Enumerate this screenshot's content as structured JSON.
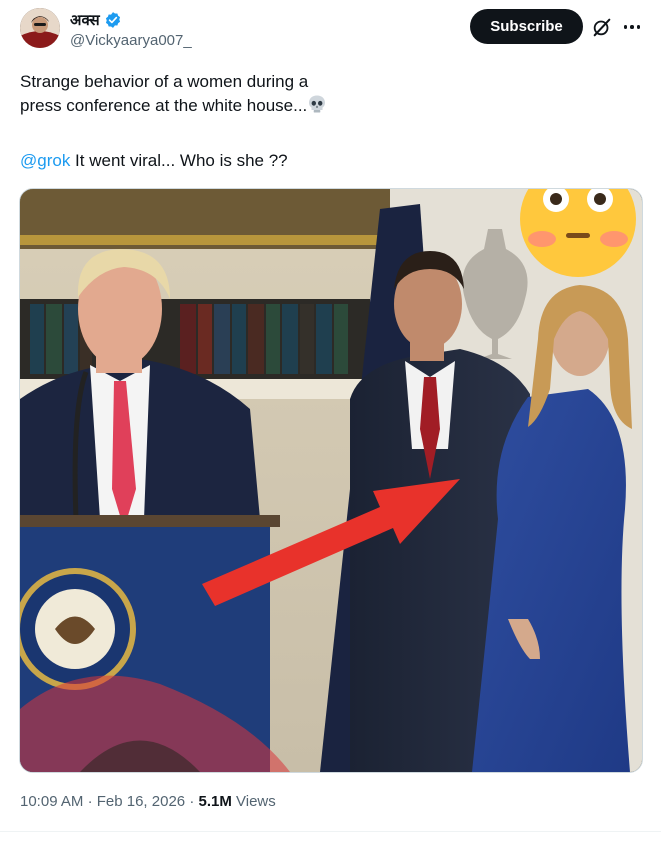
{
  "author": {
    "display_name": "अक्स",
    "handle": "@Vickyaarya007_"
  },
  "actions": {
    "subscribe_label": "Subscribe"
  },
  "tweet": {
    "line1": "Strange behavior of a women during a",
    "line2": "press conference at the white house...",
    "mention": "@grok",
    "question": " It went viral... Who is she ??"
  },
  "meta": {
    "time": "10:09 AM",
    "date": "Feb 16, 2026",
    "views_count": "5.1M",
    "views_label": "Views"
  },
  "colors": {
    "accent": "#1d9bf0",
    "text": "#0f1419",
    "secondary": "#536471",
    "arrow": "#e8322b"
  },
  "icons": [
    "verified-badge-icon",
    "grok-icon",
    "more-icon",
    "skull-emoji",
    "flushed-face-emoji"
  ]
}
